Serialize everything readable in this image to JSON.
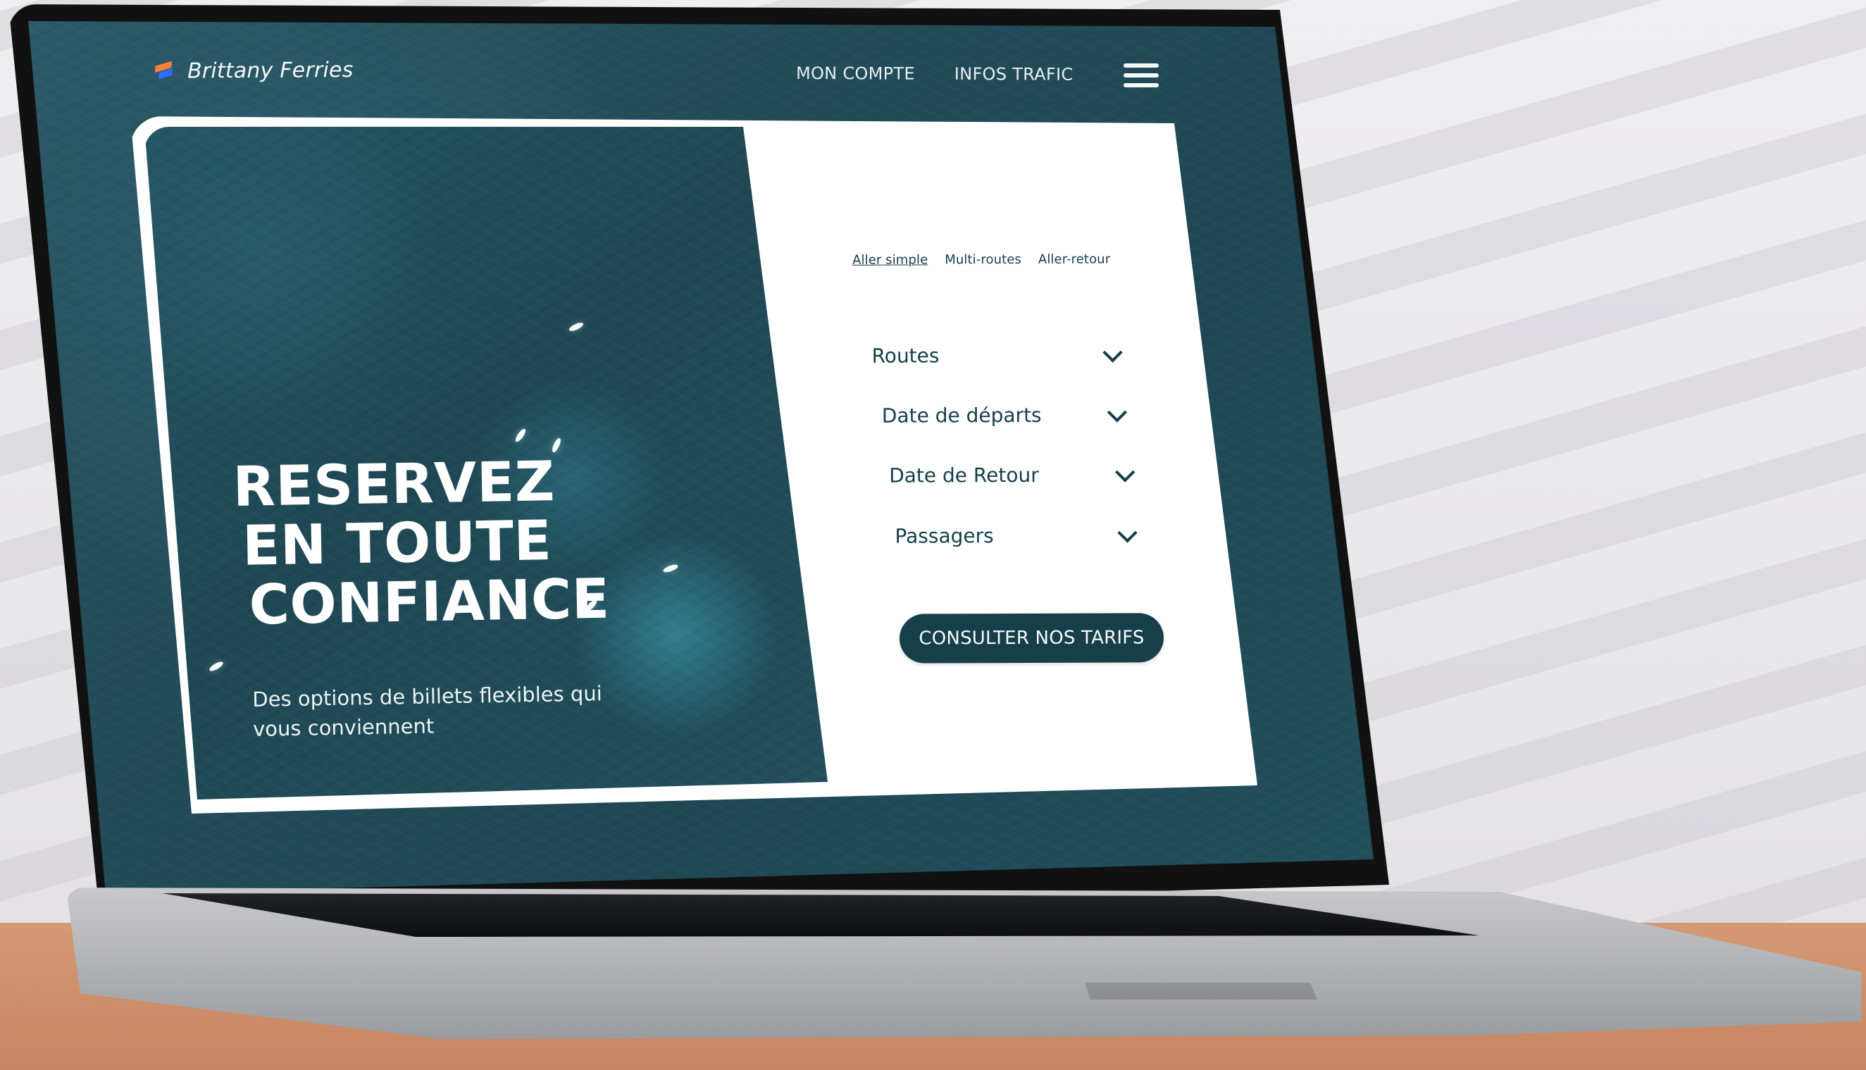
{
  "header": {
    "brand": "Brittany Ferries",
    "nav": [
      "MON COMPTE",
      "INFOS TRAFIC"
    ],
    "menu_icon": "menu-icon"
  },
  "hero": {
    "title_lines": [
      "RESERVEZ",
      "EN TOUTE",
      "CONFIANCE"
    ],
    "subtitle": "Des options de billets flexibles qui vous conviennent"
  },
  "booking": {
    "tabs": [
      "Aller simple",
      "Multi-routes",
      "Aller-retour"
    ],
    "active_tab": "Aller simple",
    "fields": [
      {
        "label": "Routes",
        "icon": "chevron-down-icon"
      },
      {
        "label": "Date de départs",
        "icon": "chevron-down-icon"
      },
      {
        "label": "Date de Retour",
        "icon": "chevron-down-icon"
      },
      {
        "label": "Passagers",
        "icon": "chevron-down-icon"
      }
    ],
    "cta": "CONSULTER NOS TARIFS"
  },
  "colors": {
    "primary": "#173f4a",
    "ocean": "#234f5c",
    "logo_orange": "#ff7e3b",
    "logo_blue": "#2f6cff"
  }
}
